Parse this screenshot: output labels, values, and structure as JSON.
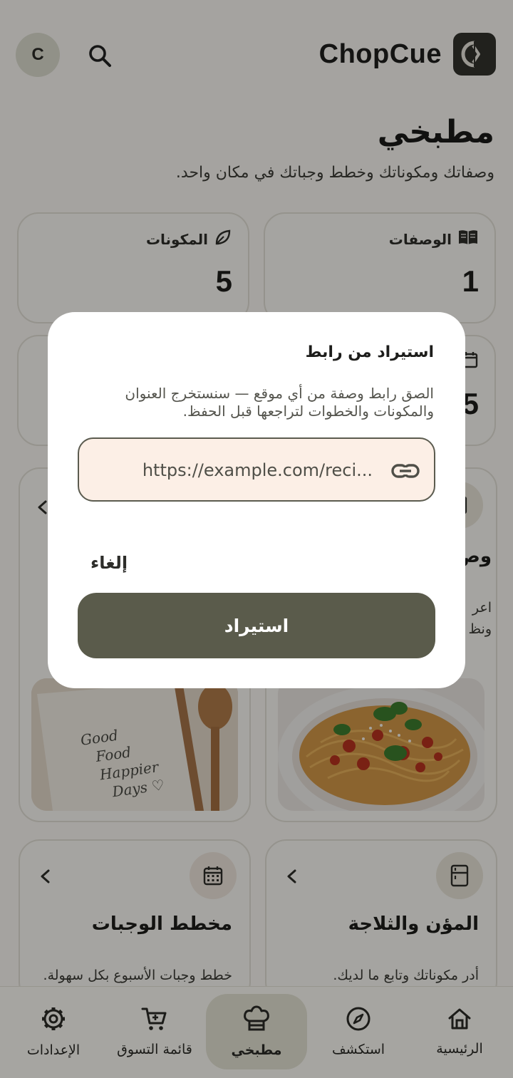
{
  "header": {
    "avatar_initial": "C",
    "brand_name": "ChopCue"
  },
  "page": {
    "title": "مطبخي",
    "subtitle": "وصفاتك ومكوناتك وخطط وجباتك في مكان واحد."
  },
  "stats": [
    {
      "label": "الوصفات",
      "value": "1",
      "icon": "recipe-book-icon"
    },
    {
      "label": "المكونات",
      "value": "5",
      "icon": "leaf-icon"
    },
    {
      "label": "",
      "value": "5",
      "icon": "calendar-icon"
    }
  ],
  "feature_cards": [
    {
      "title": "المؤن والثلاجة",
      "description": "أدر مكوناتك وتابع ما لديك.",
      "icon": "fridge-icon"
    },
    {
      "title": "مخطط الوجبات",
      "description": "خطط وجبات الأسبوع بكل سهولة.",
      "icon": "calendar-icon"
    },
    {
      "title_partial": "وص",
      "description_partial_1": "اعر",
      "description_partial_2": "ونظ"
    }
  ],
  "photos": {
    "notebook_lines": [
      "Good",
      "Food",
      "Happier",
      "Days ♡"
    ]
  },
  "dialog": {
    "title": "استيراد من رابط",
    "body": "الصق رابط وصفة من أي موقع — سنستخرج العنوان والمكونات والخطوات لتراجعها قبل الحفظ.",
    "url_placeholder": "https://example.com/reci...",
    "cancel_label": "إلغاء",
    "import_label": "استيراد"
  },
  "bottom_nav": [
    {
      "label": "الرئيسية",
      "icon": "home-icon",
      "active": false
    },
    {
      "label": "استكشف",
      "icon": "compass-icon",
      "active": false
    },
    {
      "label": "مطبخي",
      "icon": "chef-hat-icon",
      "active": true
    },
    {
      "label": "قائمة التسوق",
      "icon": "cart-icon",
      "active": false
    },
    {
      "label": "الإعدادات",
      "icon": "settings-icon",
      "active": false
    }
  ],
  "colors": {
    "primary": "#5a5b4b",
    "background": "#faf8f3",
    "url_field_bg": "#fcefe6",
    "active_nav": "#e4e3d4"
  }
}
